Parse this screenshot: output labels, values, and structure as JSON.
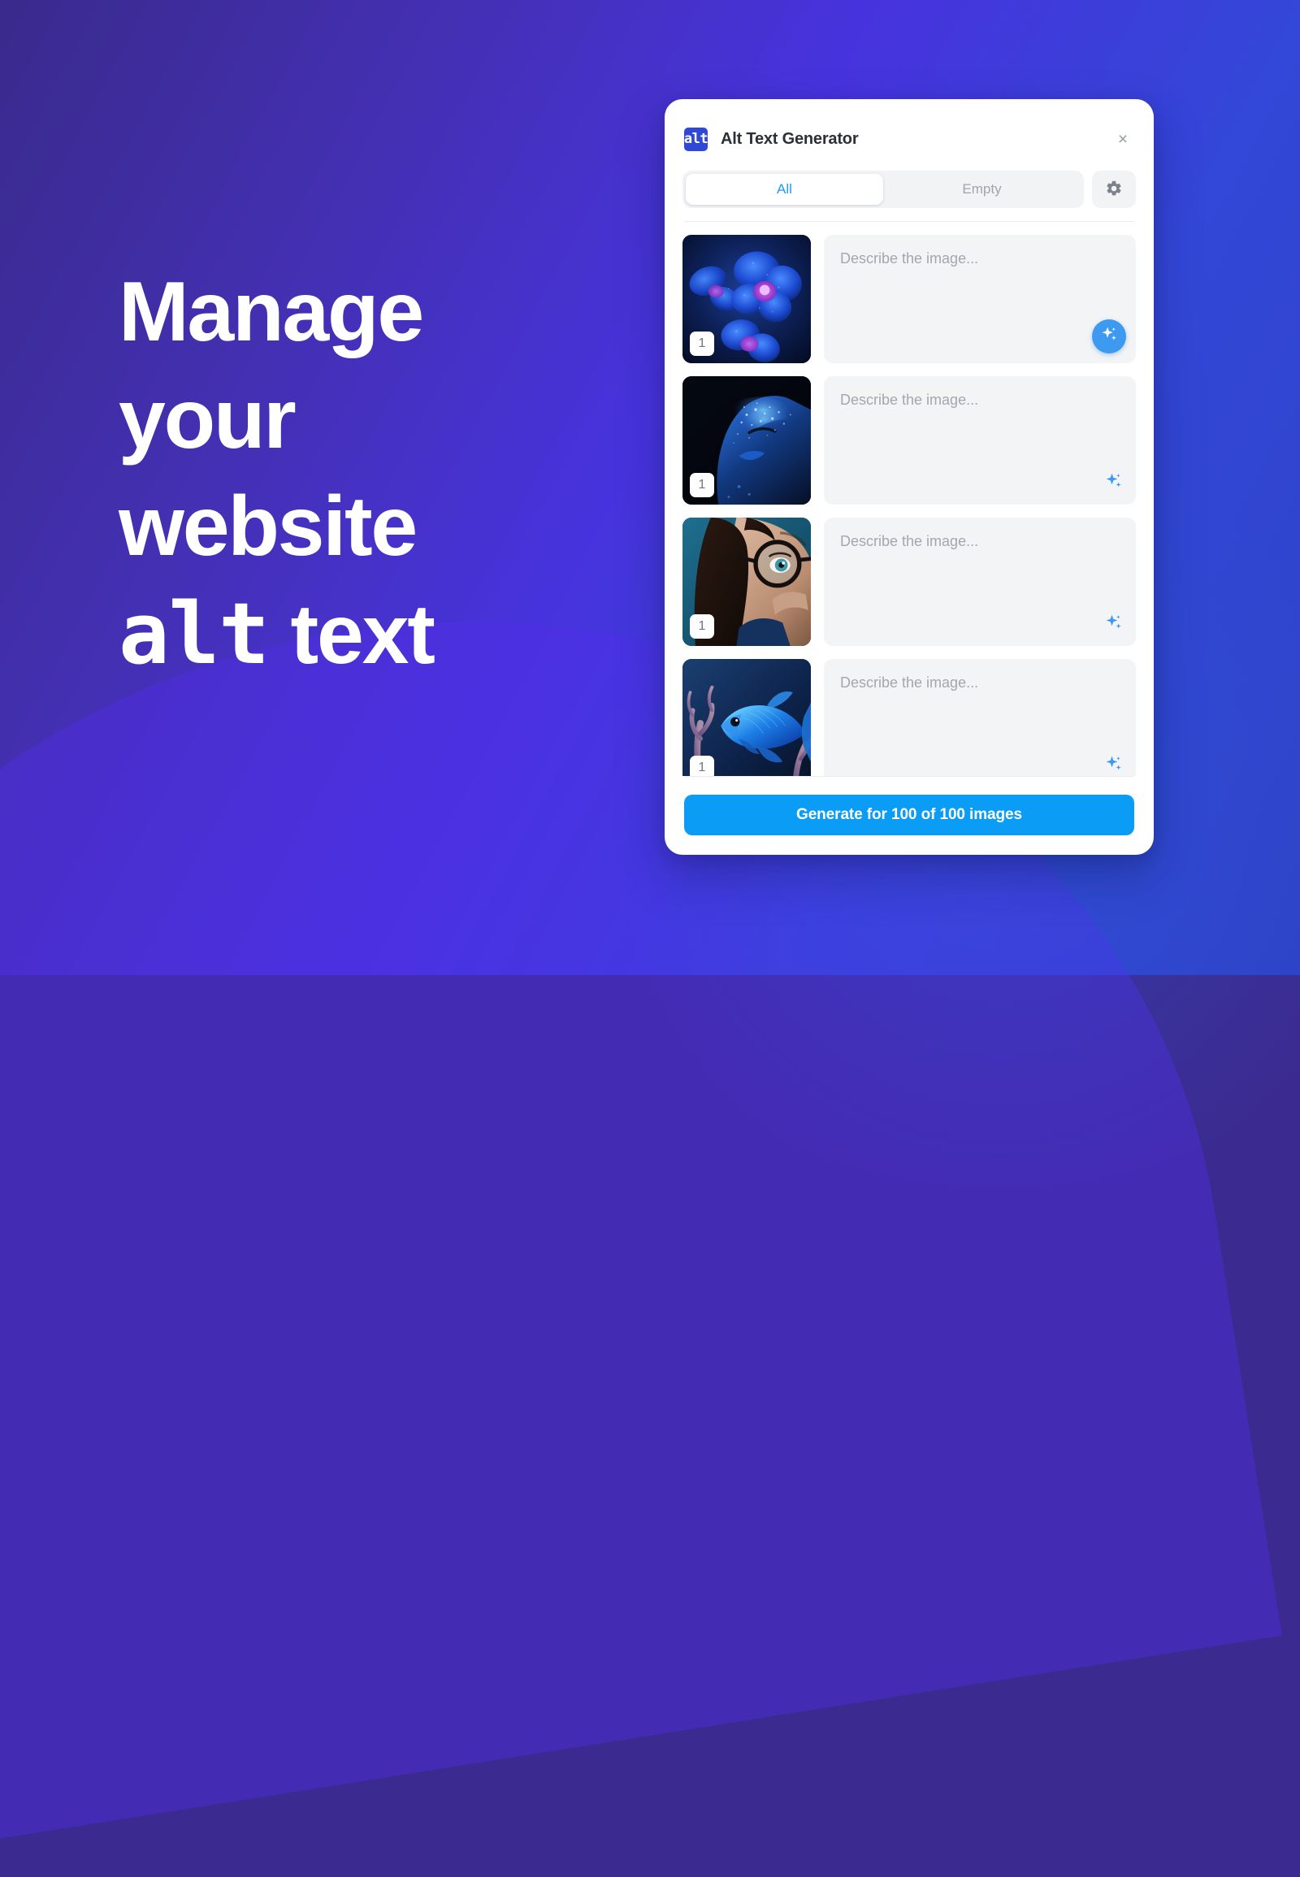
{
  "background": {
    "gradient_from": "#3a2a8c",
    "gradient_to": "#2e43c6"
  },
  "hero": {
    "line1": "Manage",
    "line2": "your",
    "line3": "website",
    "line4_mono": "alt",
    "line4_rest": " text"
  },
  "panel": {
    "logo_text": "alt",
    "title": "Alt Text Generator",
    "close_label": "×",
    "tabs": [
      {
        "label": "All",
        "active": true
      },
      {
        "label": "Empty",
        "active": false
      }
    ],
    "settings_icon": "gear-icon",
    "rows": [
      {
        "badge": "1",
        "placeholder": "Describe the image...",
        "value": "",
        "thumbnail": "blue-orchid-flowers",
        "generate_icon": "sparkle-icon",
        "generate_icon_filled": true
      },
      {
        "badge": "1",
        "placeholder": "Describe the image...",
        "value": "",
        "thumbnail": "portrait-blue-glitter-makeup",
        "generate_icon": "sparkle-icon",
        "generate_icon_filled": false
      },
      {
        "badge": "1",
        "placeholder": "Describe the image...",
        "value": "",
        "thumbnail": "woman-with-glasses-closeup",
        "generate_icon": "sparkle-icon",
        "generate_icon_filled": false
      },
      {
        "badge": "1",
        "placeholder": "Describe the image...",
        "value": "",
        "thumbnail": "blue-fish-coral-reef",
        "generate_icon": "sparkle-icon",
        "generate_icon_filled": false
      }
    ],
    "generate_button": "Generate for 100 of 100 images",
    "accent_color": "#0b9cf5",
    "logo_color": "#3048d8"
  }
}
